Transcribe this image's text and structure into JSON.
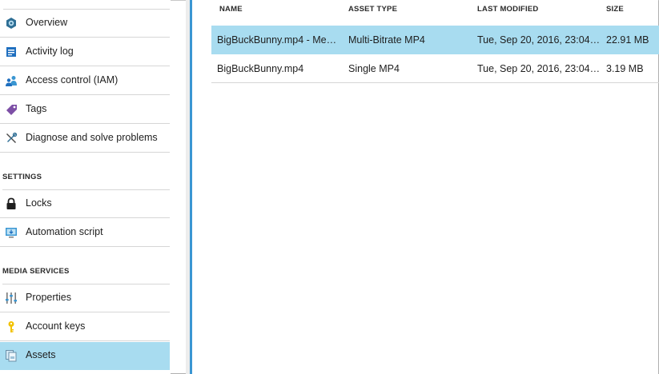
{
  "sidebar": {
    "items": [
      {
        "label": "Overview",
        "icon": "overview-hex-icon"
      },
      {
        "label": "Activity log",
        "icon": "activity-log-icon"
      },
      {
        "label": "Access control (IAM)",
        "icon": "users-icon"
      },
      {
        "label": "Tags",
        "icon": "tag-icon"
      },
      {
        "label": "Diagnose and solve problems",
        "icon": "wrench-icon"
      }
    ],
    "sections": [
      {
        "header": "SETTINGS",
        "items": [
          {
            "label": "Locks",
            "icon": "lock-icon"
          },
          {
            "label": "Automation script",
            "icon": "automation-script-icon"
          }
        ]
      },
      {
        "header": "MEDIA SERVICES",
        "items": [
          {
            "label": "Properties",
            "icon": "properties-sliders-icon"
          },
          {
            "label": "Account keys",
            "icon": "key-icon"
          },
          {
            "label": "Assets",
            "icon": "assets-icon",
            "active": true
          }
        ]
      }
    ]
  },
  "assets_table": {
    "columns": [
      "NAME",
      "ASSET TYPE",
      "LAST MODIFIED",
      "SIZE"
    ],
    "rows": [
      {
        "name": "BigBuckBunny.mp4 - Medi...",
        "asset_type": "Multi-Bitrate MP4",
        "last_modified": "Tue, Sep 20, 2016, 23:04 P...",
        "size": "22.91 MB",
        "selected": true
      },
      {
        "name": "BigBuckBunny.mp4",
        "asset_type": "Single MP4",
        "last_modified": "Tue, Sep 20, 2016, 23:04 P...",
        "size": "3.19 MB",
        "selected": false
      }
    ]
  },
  "colors": {
    "selection": "#a8dcf0",
    "accent_blue": "#3a96d2",
    "row_divider": "#d6d6d6"
  }
}
